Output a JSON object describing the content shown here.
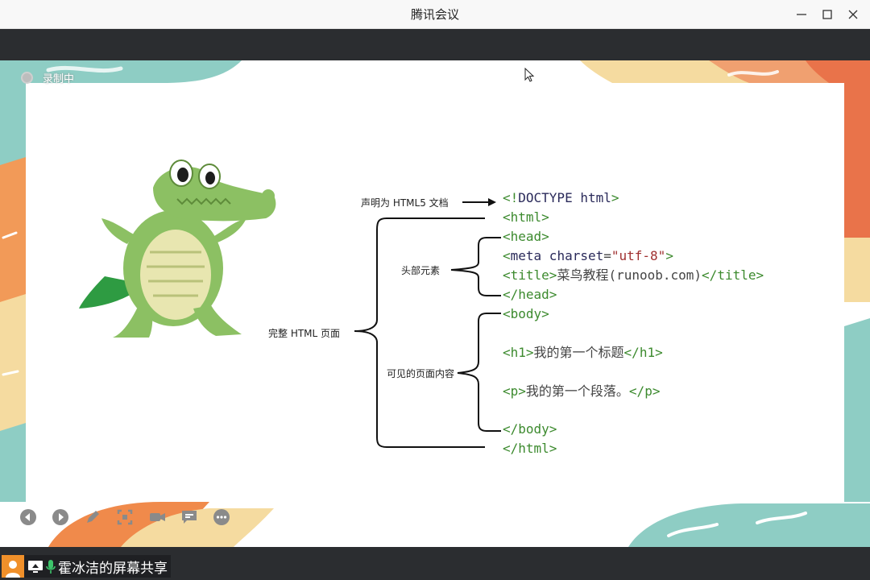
{
  "window": {
    "title": "腾讯会议"
  },
  "recording": {
    "label": "录制中"
  },
  "slide": {
    "labels": {
      "declare": "声明为 HTML5 文档",
      "head_elements": "头部元素",
      "full_page": "完整 HTML 页面",
      "visible_content": "可见的页面内容"
    },
    "code": {
      "doctype_open": "<!",
      "doctype_kw": "DOCTYPE html",
      "doctype_close": ">",
      "html_open": "<html>",
      "head_open": "<head>",
      "meta_open": "<",
      "meta_kw": "meta charset",
      "meta_eq": "=",
      "meta_val": "\"utf-8\"",
      "meta_close": ">",
      "title_open": "<title>",
      "title_text": "菜鸟教程(runoob.com)",
      "title_close": "</title>",
      "head_close": "</head>",
      "body_open": "<body>",
      "h1_open": "<h1>",
      "h1_text": "我的第一个标题",
      "h1_close": "</h1>",
      "p_open": "<p>",
      "p_text": "我的第一个段落。",
      "p_close": "</p>",
      "body_close": "</body>",
      "html_close": "</html>"
    }
  },
  "sharing": {
    "label": "霍冰洁的屏幕共享"
  },
  "colors": {
    "bar_dark": "#2b2d30",
    "teal": "#8ecdc4",
    "orange": "#f08a4b",
    "cream": "#f5dba0",
    "tag_green": "#3c8a2e",
    "string_red": "#a03030"
  },
  "icons": {
    "window": [
      "minimize-icon",
      "maximize-icon",
      "close-icon"
    ],
    "toolbar": [
      "previous-icon",
      "play-icon",
      "pen-icon",
      "screenshot-icon",
      "camera-icon",
      "comment-icon",
      "more-icon"
    ],
    "sharing": [
      "user-avatar-icon",
      "screen-share-icon",
      "microphone-icon"
    ]
  }
}
